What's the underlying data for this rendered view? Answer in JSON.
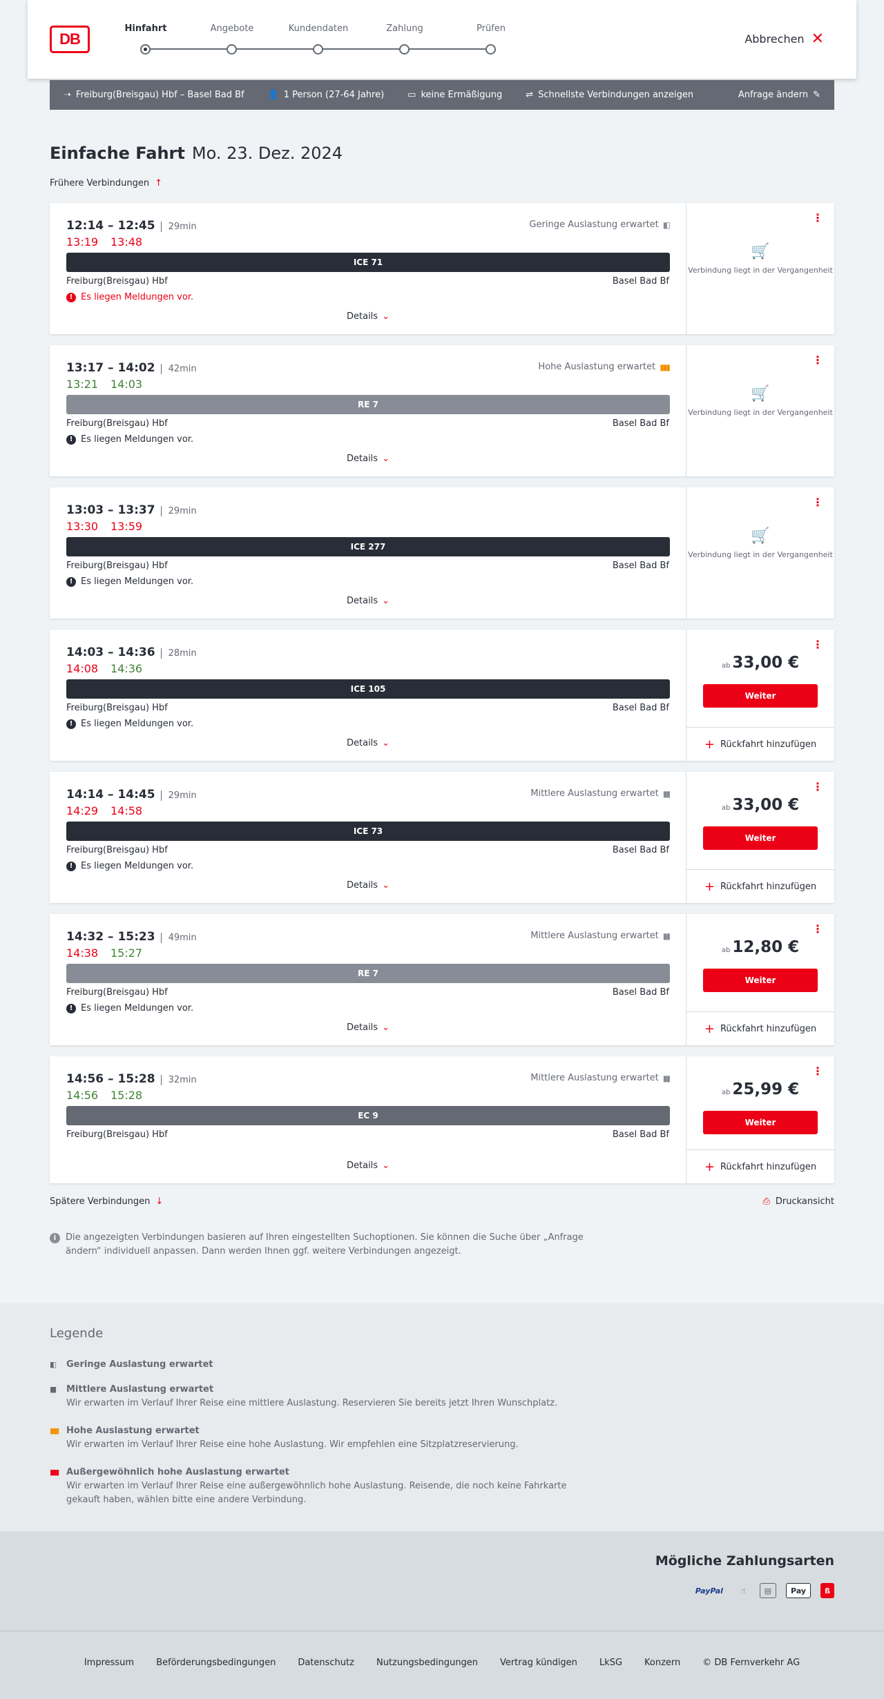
{
  "header": {
    "steps": [
      {
        "label": "Hinfahrt",
        "active": true
      },
      {
        "label": "Angebote",
        "active": false
      },
      {
        "label": "Kundendaten",
        "active": false
      },
      {
        "label": "Zahlung",
        "active": false
      },
      {
        "label": "Prüfen",
        "active": false
      }
    ],
    "cancel_label": "Abbrechen",
    "logo_text": "DB"
  },
  "summary": {
    "route": "Freiburg(Breisgau) Hbf – Basel Bad Bf",
    "persons": "1 Person (27-64 Jahre)",
    "discount": "keine Ermäßigung",
    "fastest": "Schnellste Verbindungen anzeigen",
    "change": "Anfrage ändern"
  },
  "title": {
    "trip_type": "Einfache Fahrt",
    "date": "Mo. 23. Dez. 2024"
  },
  "earlier_label": "Frühere Verbindungen",
  "later_label": "Spätere Verbindungen",
  "print_label": "Druckansicht",
  "info_text": "Die angezeigten Verbindungen basieren auf Ihren eingestellten Suchoptionen. Sie können die Suche über „Anfrage ändern“ individuell anpassen. Dann werden Ihnen ggf. weitere Verbindungen angezeigt.",
  "connections": [
    {
      "time": "12:14 – 12:45",
      "duration": "29min",
      "rt_dep": "13:19",
      "rt_arr": "13:48",
      "rt_dep_color": "#ec0016",
      "rt_arr_color": "#ec0016",
      "load": "Geringe Auslastung erwartet",
      "train": "ICE 71",
      "train_color": "#282d37",
      "from": "Freiburg(Breisgau) Hbf",
      "to": "Basel Bad Bf",
      "message": "Es liegen Meldungen vor.",
      "message_warn": true,
      "details": "Details",
      "past": "Verbindung liegt in der Vergangenheit"
    },
    {
      "time": "13:17 – 14:02",
      "duration": "42min",
      "rt_dep": "13:21",
      "rt_arr": "14:03",
      "rt_dep_color": "#408335",
      "rt_arr_color": "#408335",
      "load": "Hohe Auslastung erwartet",
      "train": "RE 7",
      "train_color": "#878c96",
      "from": "Freiburg(Breisgau) Hbf",
      "to": "Basel Bad Bf",
      "message": "Es liegen Meldungen vor.",
      "message_warn": false,
      "details": "Details",
      "past": "Verbindung liegt in der Vergangenheit"
    },
    {
      "time": "13:03 – 13:37",
      "duration": "29min",
      "rt_dep": "13:30",
      "rt_arr": "13:59",
      "rt_dep_color": "#ec0016",
      "rt_arr_color": "#ec0016",
      "load": "",
      "train": "ICE 277",
      "train_color": "#282d37",
      "from": "Freiburg(Breisgau) Hbf",
      "to": "Basel Bad Bf",
      "message": "Es liegen Meldungen vor.",
      "message_warn": false,
      "details": "Details",
      "past": "Verbindung liegt in der Vergangenheit"
    },
    {
      "time": "14:03 – 14:36",
      "duration": "28min",
      "rt_dep": "14:08",
      "rt_arr": "14:36",
      "rt_dep_color": "#ec0016",
      "rt_arr_color": "#408335",
      "load": "",
      "train": "ICE 105",
      "train_color": "#282d37",
      "from": "Freiburg(Breisgau) Hbf",
      "to": "Basel Bad Bf",
      "message": "Es liegen Meldungen vor.",
      "message_warn": false,
      "details": "Details",
      "price_prefix": "ab",
      "price": "33,00 €",
      "weiter": "Weiter",
      "return": "Rückfahrt hinzufügen"
    },
    {
      "time": "14:14 – 14:45",
      "duration": "29min",
      "rt_dep": "14:29",
      "rt_arr": "14:58",
      "rt_dep_color": "#ec0016",
      "rt_arr_color": "#ec0016",
      "load": "Mittlere Auslastung erwartet",
      "train": "ICE 73",
      "train_color": "#282d37",
      "from": "Freiburg(Breisgau) Hbf",
      "to": "Basel Bad Bf",
      "message": "Es liegen Meldungen vor.",
      "message_warn": false,
      "details": "Details",
      "price_prefix": "ab",
      "price": "33,00 €",
      "weiter": "Weiter",
      "return": "Rückfahrt hinzufügen"
    },
    {
      "time": "14:32 – 15:23",
      "duration": "49min",
      "rt_dep": "14:38",
      "rt_arr": "15:27",
      "rt_dep_color": "#ec0016",
      "rt_arr_color": "#408335",
      "load": "Mittlere Auslastung erwartet",
      "train": "RE 7",
      "train_color": "#878c96",
      "from": "Freiburg(Breisgau) Hbf",
      "to": "Basel Bad Bf",
      "message": "Es liegen Meldungen vor.",
      "message_warn": false,
      "details": "Details",
      "price_prefix": "ab",
      "price": "12,80 €",
      "weiter": "Weiter",
      "return": "Rückfahrt hinzufügen"
    },
    {
      "time": "14:56 – 15:28",
      "duration": "32min",
      "rt_dep": "14:56",
      "rt_arr": "15:28",
      "rt_dep_color": "#408335",
      "rt_arr_color": "#408335",
      "load": "Mittlere Auslastung erwartet",
      "train": "EC 9",
      "train_color": "#646973",
      "from": "Freiburg(Breisgau) Hbf",
      "to": "Basel Bad Bf",
      "message": "",
      "message_warn": false,
      "details": "Details",
      "price_prefix": "ab",
      "price": "25,99 €",
      "weiter": "Weiter",
      "return": "Rückfahrt hinzufügen"
    }
  ],
  "legend": {
    "title": "Legende",
    "items": [
      {
        "label": "Geringe Auslastung erwartet",
        "desc": ""
      },
      {
        "label": "Mittlere Auslastung erwartet",
        "desc": "Wir erwarten im Verlauf Ihrer Reise eine mittlere Auslastung. Reservieren Sie bereits jetzt Ihren Wunschplatz."
      },
      {
        "label": "Hohe Auslastung erwartet",
        "desc": "Wir erwarten im Verlauf Ihrer Reise eine hohe Auslastung. Wir empfehlen eine Sitzplatzreservierung."
      },
      {
        "label": "Außergewöhnlich hohe Auslastung erwartet",
        "desc": "Wir erwarten im Verlauf Ihrer Reise eine außergewöhnlich hohe Auslastung. Reisende, die noch keine Fahrkarte gekauft haben, wählen bitte eine andere Verbindung."
      }
    ]
  },
  "payment": {
    "title": "Mögliche Zahlungsarten",
    "methods": [
      "PayPal",
      "",
      "",
      "Pay",
      ""
    ]
  },
  "footer": {
    "links": [
      "Impressum",
      "Beförderungsbedingungen",
      "Datenschutz",
      "Nutzungsbedingungen",
      "Vertrag kündigen",
      "LkSG",
      "Konzern",
      "© DB Fernverkehr AG"
    ]
  },
  "colors": {
    "accent": "#ec0016",
    "on_time": "#408335",
    "dark": "#282d37"
  }
}
